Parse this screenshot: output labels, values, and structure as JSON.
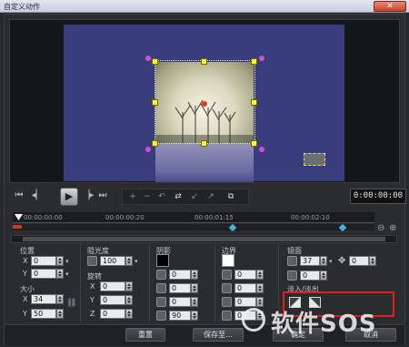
{
  "window": {
    "title": "自定义动作",
    "close_glyph": "✕"
  },
  "transport": {
    "icons": [
      "skip-start-icon",
      "step-back-icon",
      "play-icon",
      "step-forward-icon",
      "skip-end-icon"
    ],
    "play_glyph": "▶",
    "timecode": "0:00:00:00"
  },
  "timeline": {
    "ticks": [
      "00:00:00:00",
      "00:00:00:20",
      "00:00:01:15",
      "00:00:02:10"
    ]
  },
  "panel": {
    "position": {
      "label": "位置",
      "x_axis": "X",
      "y_axis": "Y",
      "x": "0",
      "y": "0"
    },
    "size": {
      "label": "大小",
      "x_axis": "X",
      "y_axis": "Y",
      "x": "34",
      "y": "50"
    },
    "opacity": {
      "label": "阻光度",
      "value": "100"
    },
    "rotation": {
      "label": "旋转",
      "x_axis": "X",
      "y_axis": "Y",
      "z_axis": "Z",
      "x": "0",
      "y": "0",
      "z": "0"
    },
    "shadow": {
      "label": "阴影",
      "color": "#000000",
      "v1": "0",
      "v2": "0",
      "v3": "0",
      "v4": "90"
    },
    "border": {
      "label": "边界",
      "color": "#ffffff",
      "v1": "0",
      "v2": "0",
      "v3": "0",
      "v4": "0"
    },
    "mirror": {
      "label": "镜面",
      "v1": "37",
      "v2": "0",
      "v3": "0"
    },
    "fade": {
      "label": "淡入/淡出"
    }
  },
  "buttons": {
    "reset": "重置",
    "save_as": "保存至...",
    "ok": "确定",
    "cancel": "取消"
  },
  "watermark": {
    "text": "软件SOS"
  }
}
